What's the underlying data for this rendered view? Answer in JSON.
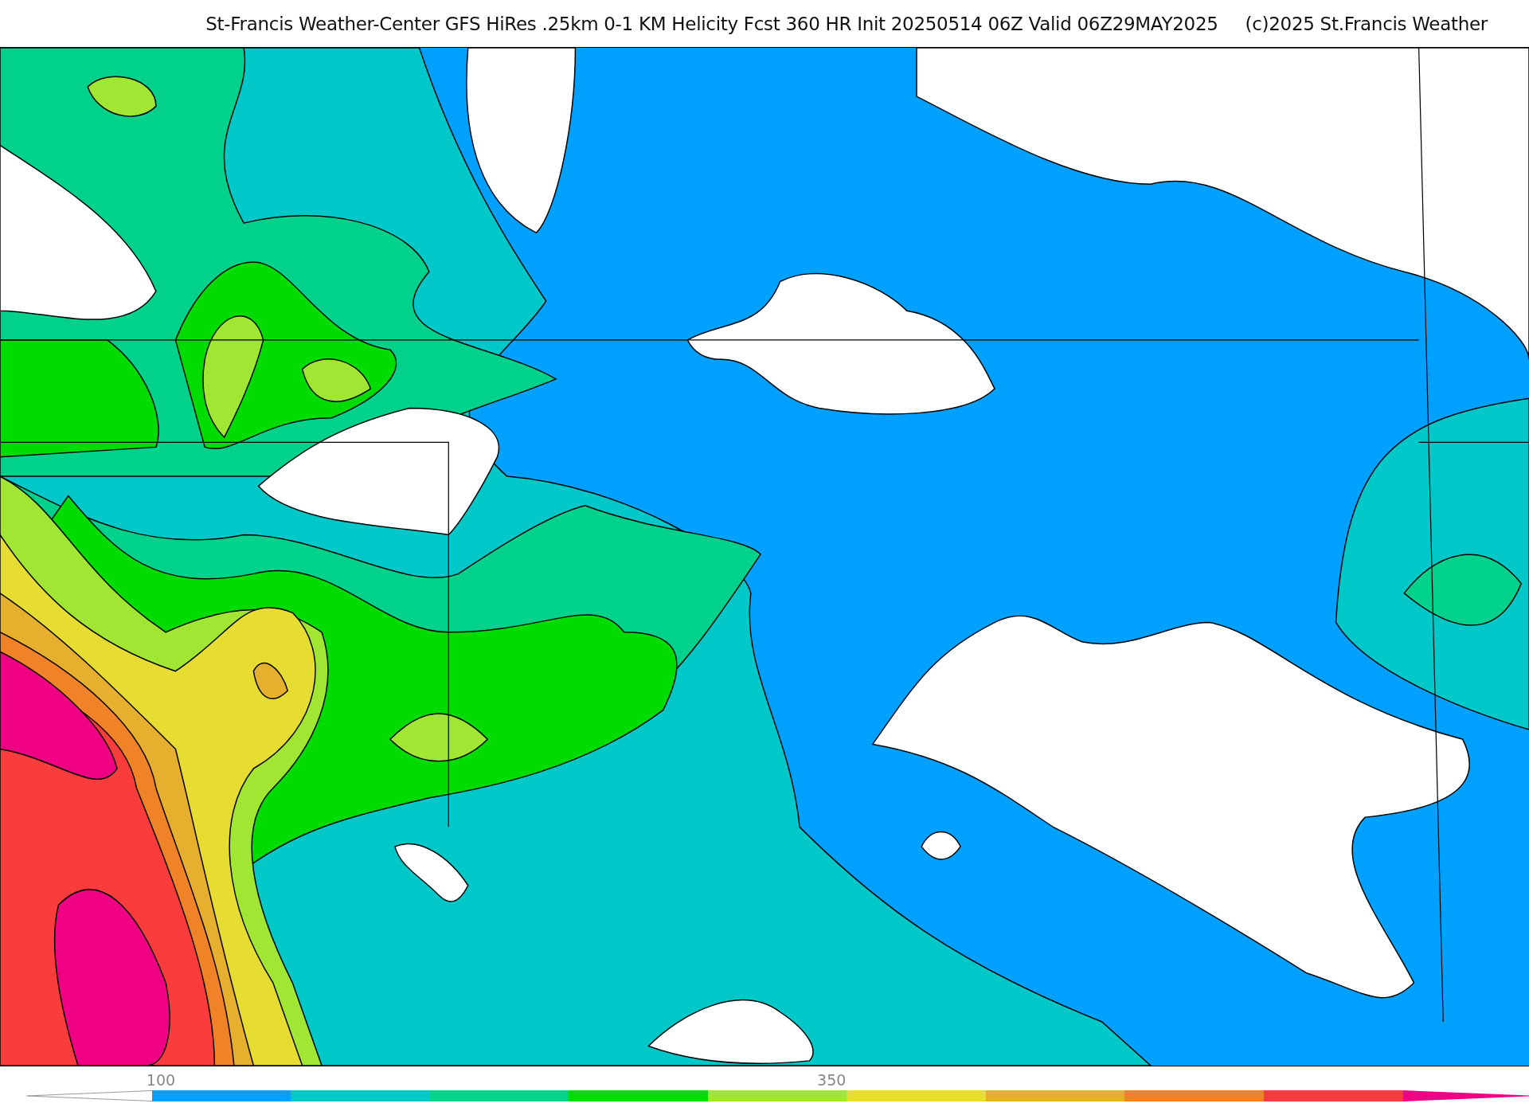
{
  "header": {
    "title": "St-Francis Weather-Center GFS HiRes .25km 0-1 KM Helicity Fcst 360 HR Init 20250514 06Z  Valid 06Z29MAY2025",
    "copyright": "(c)2025 St.Francis Weather"
  },
  "colorbar": {
    "segments": [
      {
        "color": "#00a0ff",
        "label": "100"
      },
      {
        "color": "#00c8c8"
      },
      {
        "color": "#00d28c"
      },
      {
        "color": "#00dc00"
      },
      {
        "color": "#a0e632"
      },
      {
        "color": "#e6dc32",
        "label": "350"
      },
      {
        "color": "#e6af2d"
      },
      {
        "color": "#f08228"
      },
      {
        "color": "#fa3c3c"
      },
      {
        "color": "#f00082"
      }
    ]
  }
}
